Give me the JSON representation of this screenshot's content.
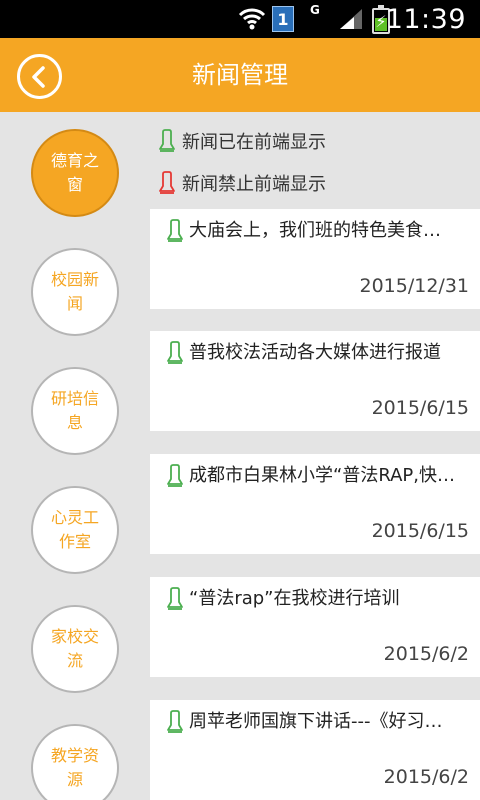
{
  "status_bar": {
    "time": "11:39",
    "sim_slot": "1",
    "network_type": "G",
    "icons": [
      "wifi-icon",
      "sim-icon",
      "signal-icon",
      "battery-charging-icon"
    ]
  },
  "header": {
    "title": "新闻管理",
    "back_icon": "back-arrow-icon",
    "color": "#f5a623"
  },
  "sidebar": {
    "items": [
      {
        "label": "德育之窗",
        "active": true
      },
      {
        "label": "校园新闻",
        "active": false
      },
      {
        "label": "研培信息",
        "active": false
      },
      {
        "label": "心灵工作室",
        "active": false
      },
      {
        "label": "家校交流",
        "active": false
      },
      {
        "label": "教学资源",
        "active": false
      }
    ]
  },
  "legend": {
    "shown": {
      "label": "新闻已在前端显示",
      "color": "#4caf50",
      "icon": "bell-green-icon"
    },
    "hidden": {
      "label": "新闻禁止前端显示",
      "color": "#e53935",
      "icon": "bell-red-icon"
    }
  },
  "news": [
    {
      "title": "大庙会上，我们班的特色美食…",
      "date": "2015/12/31",
      "status": "shown"
    },
    {
      "title": "普我校法活动各大媒体进行报道",
      "date": "2015/6/15",
      "status": "shown"
    },
    {
      "title": "成都市白果林小学“普法RAP,快…",
      "date": "2015/6/15",
      "status": "shown"
    },
    {
      "title": "“普法rap”在我校进行培训",
      "date": "2015/6/2",
      "status": "shown"
    },
    {
      "title": "周苹老师国旗下讲话---《好习…",
      "date": "2015/6/2",
      "status": "shown"
    }
  ]
}
